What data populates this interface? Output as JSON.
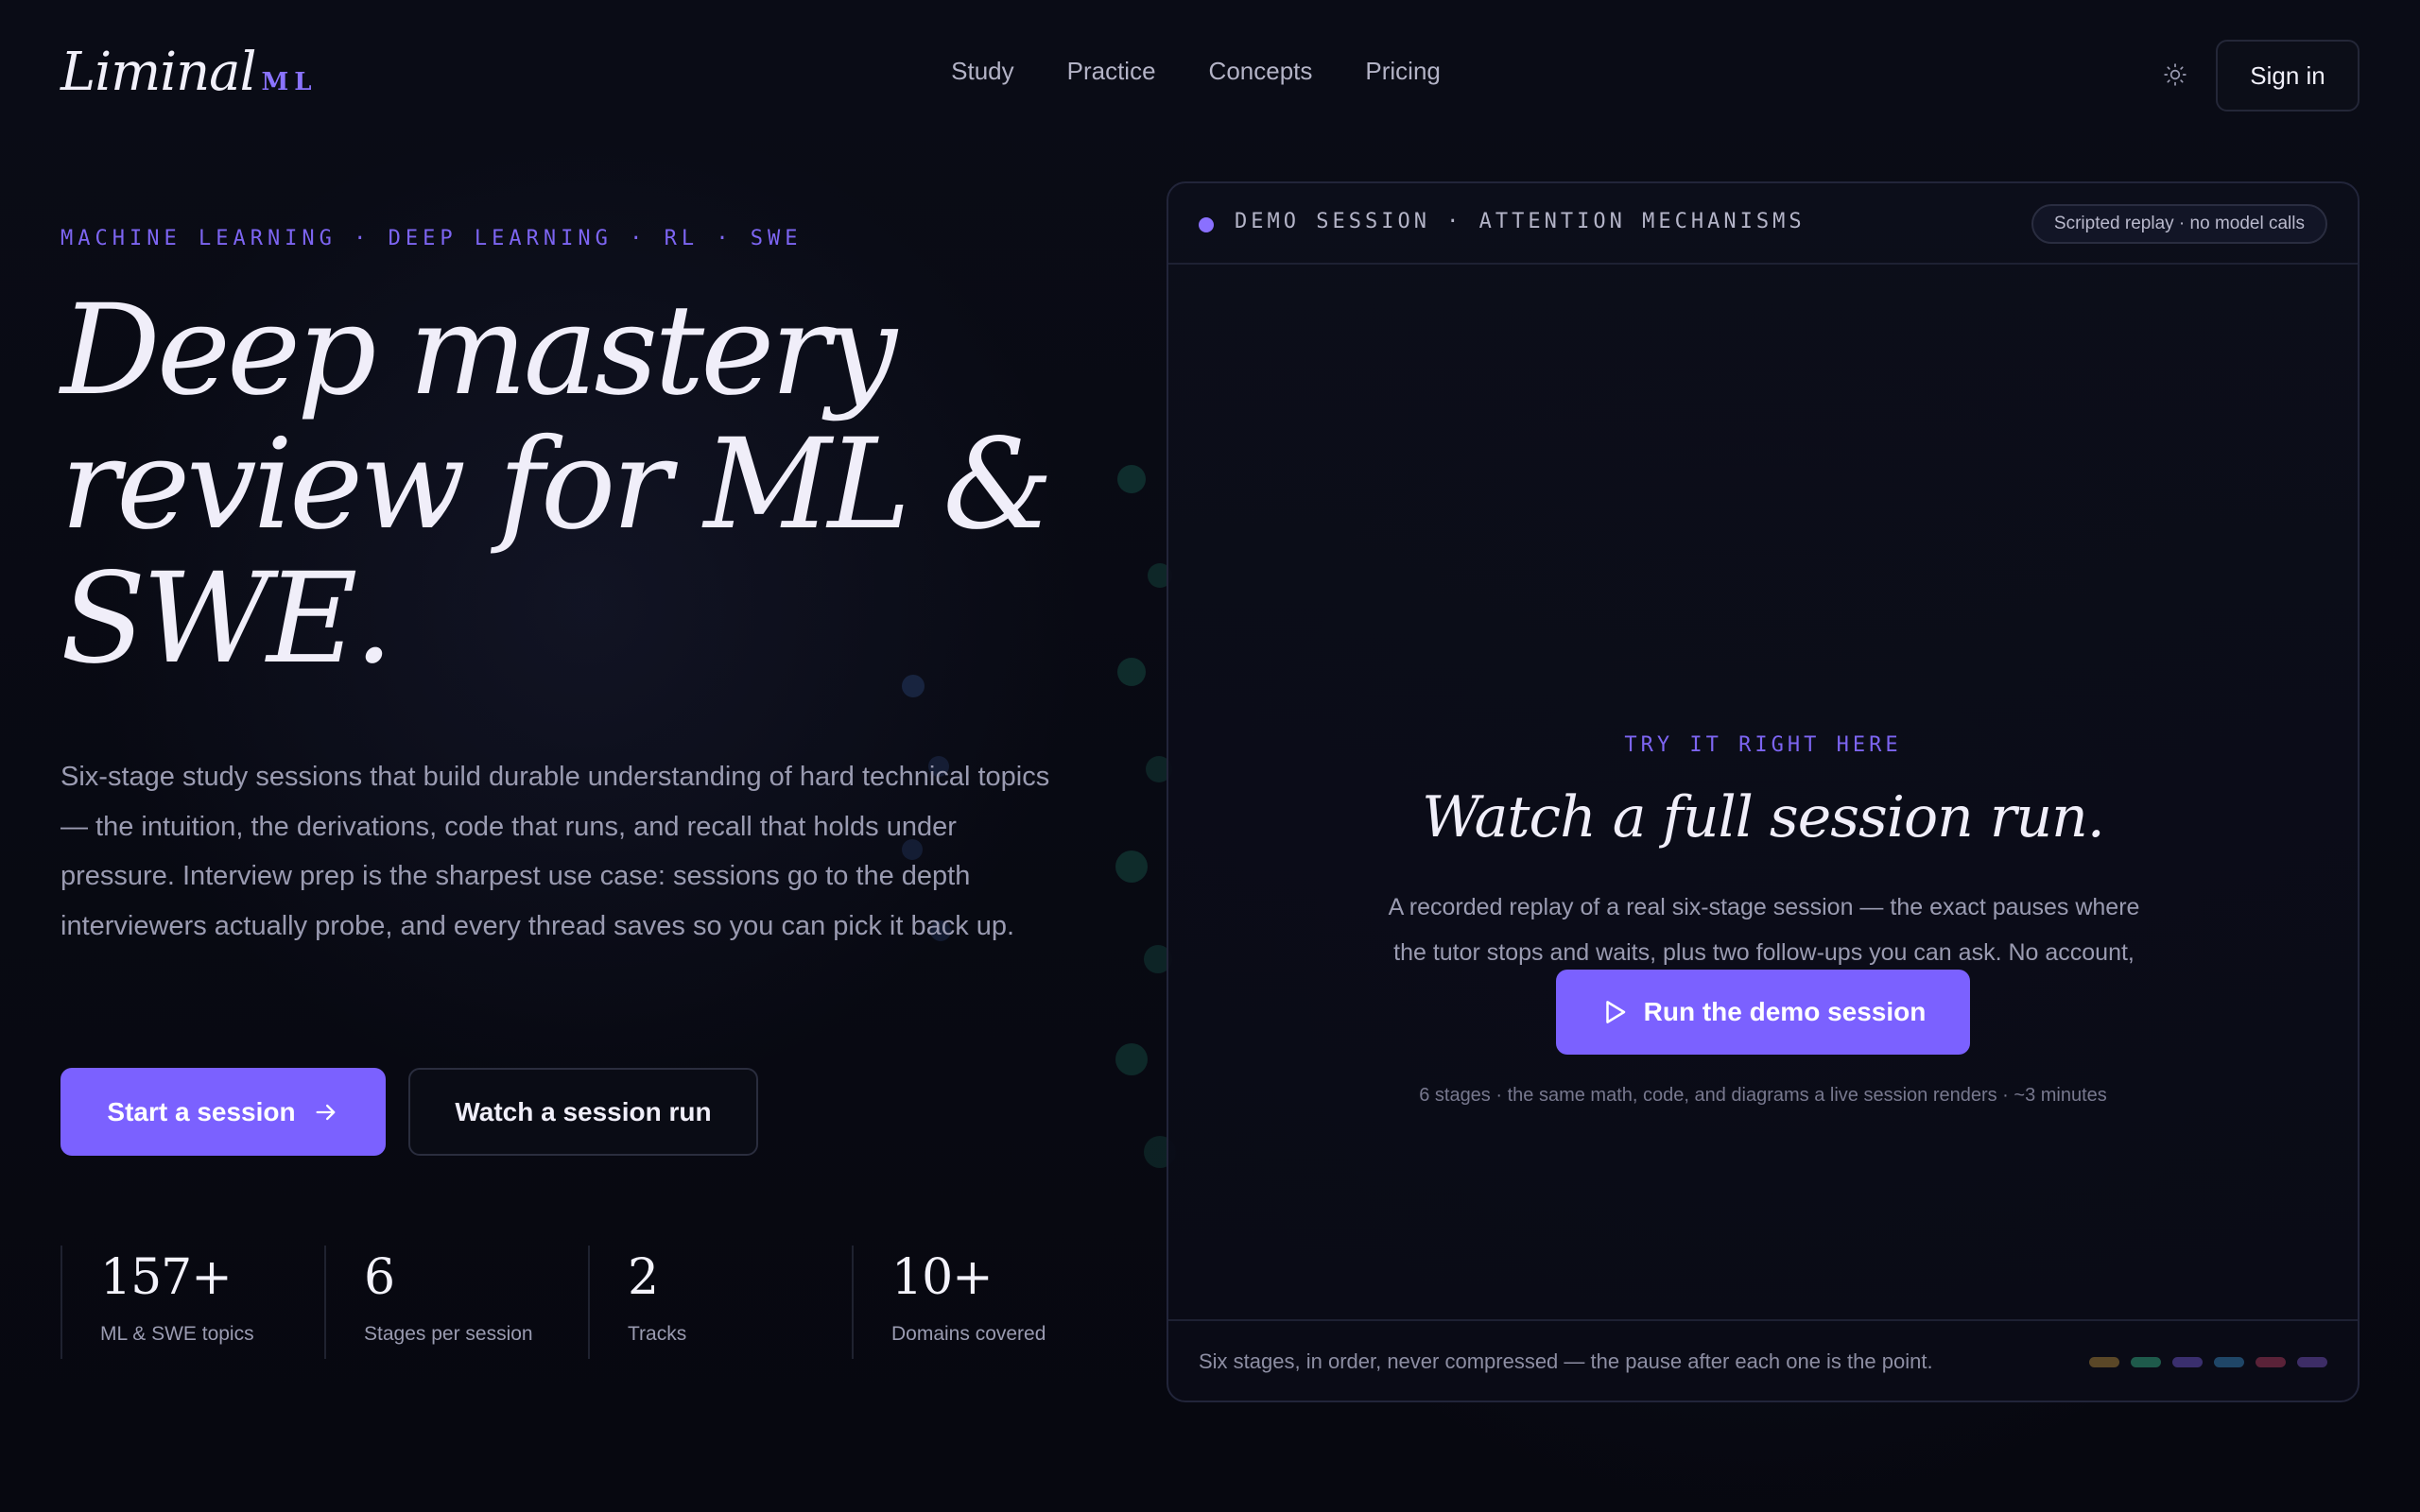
{
  "brand": {
    "name": "Liminal",
    "suffix": "ML"
  },
  "nav": [
    "Study",
    "Practice",
    "Concepts",
    "Pricing"
  ],
  "header": {
    "signin_label": "Sign in",
    "theme_icon": "sun-icon"
  },
  "hero": {
    "eyebrow": "MACHINE LEARNING · DEEP LEARNING · RL · SWE",
    "headline_lines": [
      "Deep mastery",
      "review for ML &",
      "SWE."
    ],
    "lede": "Six-stage study sessions that build durable understanding of hard technical topics — the intuition, the derivations, code that runs, and recall that holds under pressure. Interview prep is the sharpest use case: sessions go to the depth interviewers actually probe, and every thread saves so you can pick it back up.",
    "primary_cta": "Start a session",
    "secondary_cta": "Watch a session run"
  },
  "stats": [
    {
      "value": "157+",
      "label": "ML & SWE topics"
    },
    {
      "value": "6",
      "label": "Stages per session"
    },
    {
      "value": "2",
      "label": "Tracks"
    },
    {
      "value": "10+",
      "label": "Domains covered"
    }
  ],
  "demo": {
    "title": "DEMO SESSION · ATTENTION MECHANISMS",
    "badge": "Scripted replay · no model calls",
    "eyebrow": "TRY IT RIGHT HERE",
    "heading": "Watch a full session run.",
    "description": "A recorded replay of a real six-stage session — the exact pauses where the tutor stops and waits, plus two follow-ups you can ask. No account, no model calls.",
    "run_label": "Run the demo session",
    "meta": "6 stages · the same math, code, and diagrams a live session renders · ~3 minutes",
    "footer": "Six stages, in order, never compressed — the pause after each one is the point.",
    "stage_colors": [
      "#5a4727",
      "#1e5a4b",
      "#3a2f6e",
      "#1f4667",
      "#5a2238",
      "#3d2d66"
    ]
  },
  "colors": {
    "accent": "#7b61ff",
    "background": "#07080f",
    "text": "#f0eef9",
    "muted": "#9a9bb1"
  }
}
